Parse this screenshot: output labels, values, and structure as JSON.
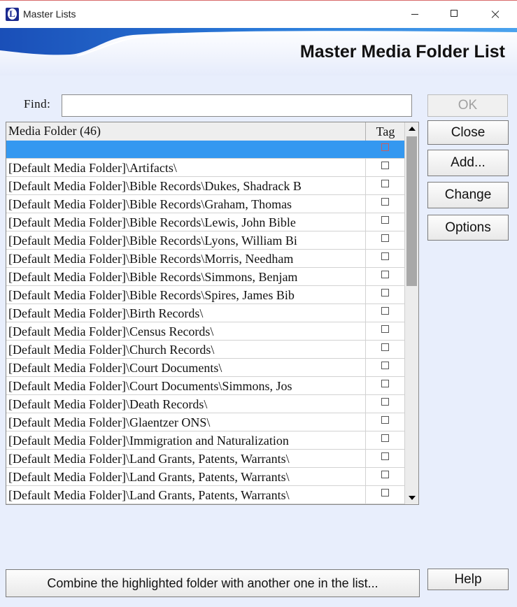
{
  "window": {
    "title": "Master Lists"
  },
  "banner": {
    "title": "Master Media Folder List"
  },
  "find": {
    "label": "Find:",
    "value": ""
  },
  "list": {
    "column_name": "Media Folder (46)",
    "column_tag": "Tag",
    "rows": [
      {
        "name": ""
      },
      {
        "name": "[Default Media Folder]\\Artifacts\\"
      },
      {
        "name": "[Default Media Folder]\\Bible Records\\Dukes, Shadrack B"
      },
      {
        "name": "[Default Media Folder]\\Bible Records\\Graham, Thomas"
      },
      {
        "name": "[Default Media Folder]\\Bible Records\\Lewis, John Bible"
      },
      {
        "name": "[Default Media Folder]\\Bible Records\\Lyons, William Bi"
      },
      {
        "name": "[Default Media Folder]\\Bible Records\\Morris, Needham"
      },
      {
        "name": "[Default Media Folder]\\Bible Records\\Simmons, Benjam"
      },
      {
        "name": "[Default Media Folder]\\Bible Records\\Spires, James Bib"
      },
      {
        "name": "[Default Media Folder]\\Birth Records\\"
      },
      {
        "name": "[Default Media Folder]\\Census Records\\"
      },
      {
        "name": "[Default Media Folder]\\Church Records\\"
      },
      {
        "name": "[Default Media Folder]\\Court Documents\\"
      },
      {
        "name": "[Default Media Folder]\\Court Documents\\Simmons, Jos"
      },
      {
        "name": "[Default Media Folder]\\Death Records\\"
      },
      {
        "name": "[Default Media Folder]\\Glaentzer ONS\\"
      },
      {
        "name": "[Default Media Folder]\\Immigration and Naturalization"
      },
      {
        "name": "[Default Media Folder]\\Land Grants, Patents, Warrants\\"
      },
      {
        "name": "[Default Media Folder]\\Land Grants, Patents, Warrants\\"
      },
      {
        "name": "[Default Media Folder]\\Land Grants, Patents, Warrants\\"
      }
    ]
  },
  "buttons": {
    "ok": "OK",
    "close": "Close",
    "add": "Add...",
    "change": "Change",
    "options": "Options",
    "combine": "Combine the highlighted folder with another one in the list...",
    "help": "Help"
  }
}
